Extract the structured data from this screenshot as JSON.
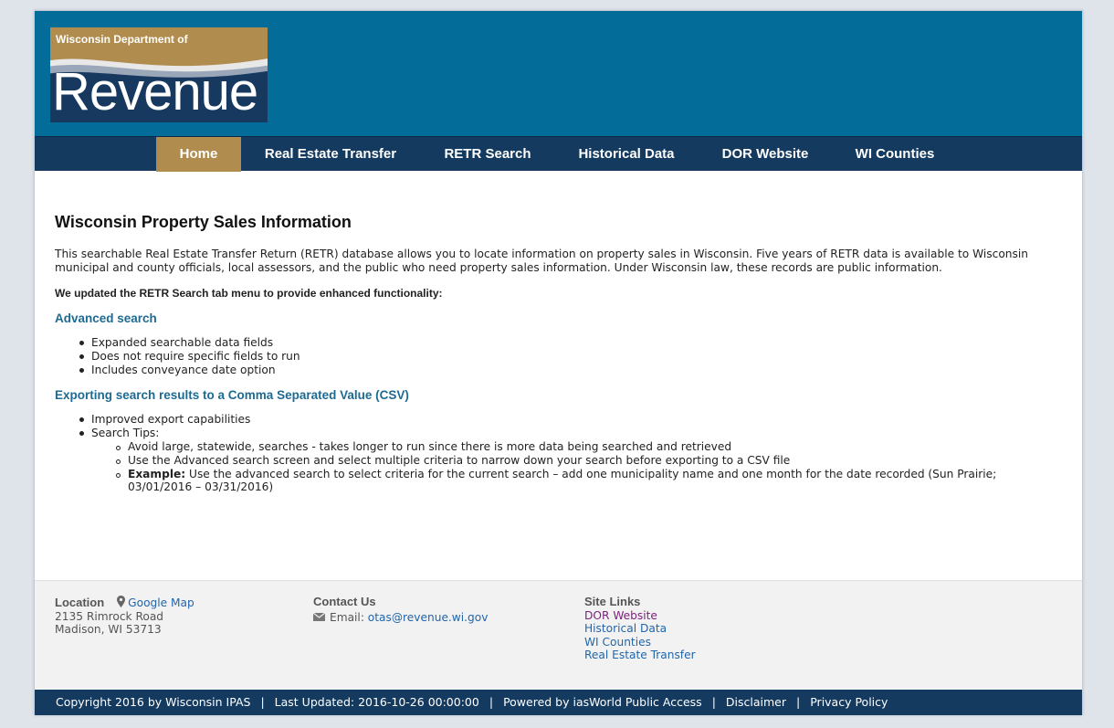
{
  "header": {
    "logo_small": "Wisconsin Department of",
    "logo_big": "Revenue",
    "colors": {
      "banner": "#036c99",
      "nav": "#143a60",
      "accent": "#b08c4e"
    }
  },
  "nav": {
    "items": [
      {
        "label": "Home",
        "active": true
      },
      {
        "label": "Real Estate Transfer"
      },
      {
        "label": "RETR Search"
      },
      {
        "label": "Historical Data"
      },
      {
        "label": "DOR Website"
      },
      {
        "label": "WI Counties"
      }
    ]
  },
  "main": {
    "title": "Wisconsin Property Sales Information",
    "intro": "This searchable Real Estate Transfer Return (RETR) database allows you to locate information on property sales in Wisconsin. Five years of RETR data is available to Wisconsin municipal and county officials, local assessors, and the public who need property sales information. Under Wisconsin law, these records are public information.",
    "notice": "We updated the RETR Search tab menu to provide enhanced functionality:",
    "sections": [
      {
        "heading": "Advanced search",
        "bullets": [
          "Expanded searchable data fields",
          "Does not require specific fields to run",
          "Includes conveyance date option"
        ]
      },
      {
        "heading": "Exporting search results to a Comma Separated Value (CSV)",
        "bullets": [
          "Improved export capabilities",
          "Search Tips:"
        ],
        "tips": [
          "Avoid large, statewide, searches - takes longer to run since there is more data being searched and retrieved",
          "Use the Advanced search screen and select multiple criteria to narrow down your search before exporting to a CSV file"
        ],
        "example_label": "Example:",
        "example_text": " Use the advanced search to select criteria for the current search – add one municipality name and one month for the date recorded (Sun Prairie; 03/01/2016 – 03/31/2016)"
      }
    ]
  },
  "footer": {
    "location": {
      "heading": "Location",
      "map_link": "Google Map",
      "address1": "2135 Rimrock Road",
      "address2": "Madison, WI 53713"
    },
    "contact": {
      "heading": "Contact Us",
      "email_label": "Email: ",
      "email": "otas@revenue.wi.gov"
    },
    "site_links": {
      "heading": "Site Links",
      "links": [
        "DOR Website",
        "Historical Data",
        "WI Counties",
        "Real Estate Transfer"
      ]
    }
  },
  "bottombar": {
    "copyright": "Copyright 2016 by Wisconsin IPAS",
    "sep": "|",
    "updated": "Last Updated: 2016-10-26 00:00:00",
    "powered": "Powered by iasWorld Public Access",
    "disclaimer": "Disclaimer",
    "privacy": "Privacy Policy"
  }
}
